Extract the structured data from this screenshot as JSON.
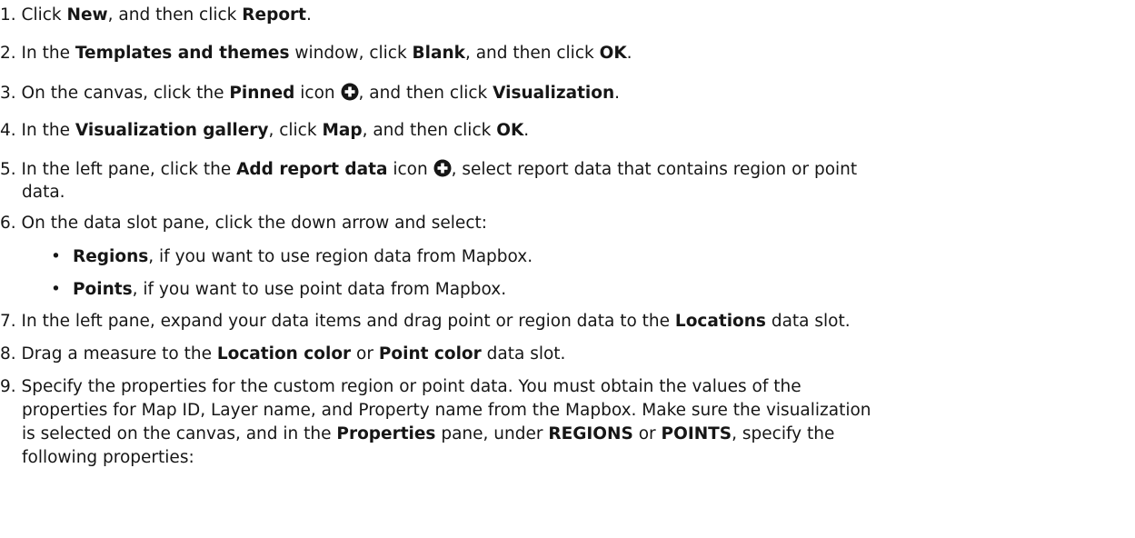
{
  "steps": [
    {
      "n": "1.",
      "parts": [
        "Click ",
        "New",
        ", and then click ",
        "Report",
        "."
      ]
    },
    {
      "n": "2.",
      "parts": [
        "In the ",
        "Templates and themes",
        " window, click ",
        "Blank",
        ", and then click ",
        "OK",
        "."
      ]
    },
    {
      "n": "3.",
      "parts": [
        "On the canvas, click the ",
        "Pinned",
        " icon ",
        ", and then click ",
        "Visualization",
        "."
      ]
    },
    {
      "n": "4.",
      "parts": [
        "In the ",
        "Visualization gallery",
        ", click ",
        "Map",
        ", and then click ",
        "OK",
        "."
      ]
    },
    {
      "n": "5.",
      "parts": [
        "In the left pane, click the ",
        "Add report data",
        " icon ",
        ", select report data that contains region or point"
      ],
      "cont": "data."
    },
    {
      "n": "6.",
      "parts": [
        "On the data slot pane, click the down arrow and select:"
      ]
    },
    {
      "n": "7.",
      "parts": [
        "In the left pane, expand your data items and drag point or region data to the ",
        "Locations",
        " data slot."
      ]
    },
    {
      "n": "8.",
      "parts": [
        "Drag a measure to the ",
        "Location color",
        " or ",
        "Point color",
        " data slot."
      ]
    },
    {
      "n": "9.",
      "lines": [
        "Specify the properties for the custom region or point data. You must obtain the values of the",
        "properties for Map ID, Layer name, and Property name from the Mapbox. Make sure the visualization"
      ],
      "line3_parts": [
        "is selected on the canvas, and in the ",
        "Properties",
        " pane, under ",
        "REGIONS",
        " or ",
        "POINTS",
        ", specify the"
      ],
      "line4": "following properties:"
    }
  ],
  "bullets": [
    {
      "parts": [
        "Regions",
        ", if you want to use region data from Mapbox."
      ]
    },
    {
      "parts": [
        "Points",
        ", if you want to use point data from Mapbox."
      ]
    }
  ],
  "icons": {
    "pinned_icon": "plus-circle-icon",
    "add_report_data_icon": "plus-circle-icon"
  }
}
